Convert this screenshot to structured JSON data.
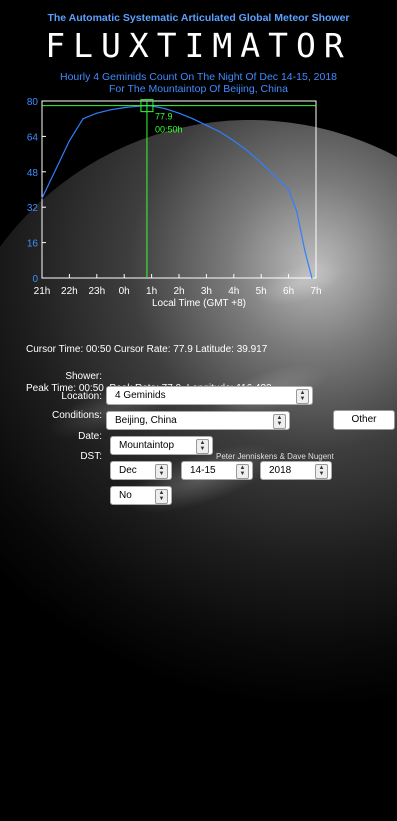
{
  "header": {
    "subtitle": "The Automatic Systematic Articulated Global Meteor Shower",
    "logo": "FLUXTIMATOR"
  },
  "chart_title_line1": "Hourly 4 Geminids  Count On The Night Of Dec 14-15, 2018",
  "chart_title_line2": "For The Mountaintop Of Beijing, China",
  "chart_data": {
    "type": "line",
    "title": "Hourly 4 Geminids  Count On The Night Of Dec 14-15, 2018 For The Mountaintop Of Beijing, China",
    "xlabel": "Local Time (GMT +8)",
    "ylabel": "",
    "x_tick_labels": [
      "21h",
      "22h",
      "23h",
      "0h",
      "1h",
      "2h",
      "3h",
      "4h",
      "5h",
      "6h",
      "7h"
    ],
    "y_ticks": [
      0,
      16,
      32,
      48,
      64,
      80
    ],
    "ylim": [
      0,
      80
    ],
    "xlim": [
      21,
      31
    ],
    "series": [
      {
        "x": [
          21,
          21.5,
          22,
          22.5,
          23,
          23.5,
          24,
          24.5,
          24.83,
          25,
          25.5,
          26,
          26.5,
          27,
          27.5,
          28,
          28.5,
          29,
          29.5,
          30,
          30.3,
          30.6,
          30.85
        ],
        "values": [
          36,
          49,
          62,
          72,
          74.5,
          76,
          77,
          77.6,
          77.9,
          77.8,
          76.5,
          74.5,
          72,
          69,
          66,
          62,
          57.5,
          52,
          46,
          40,
          30,
          12,
          0
        ]
      }
    ],
    "cursor": {
      "x": 24.83,
      "y": 77.9,
      "label_rate": "77.9",
      "label_time": "00:50h"
    },
    "colors": {
      "line": "#2f7fff",
      "cursor": "#33ff33",
      "frame": "#ffffff"
    }
  },
  "stats": {
    "cursor_time_label": "Cursor Time:",
    "cursor_time": "00:50",
    "cursor_rate_label": "Cursor Rate:",
    "cursor_rate": "77.9",
    "latitude_label": "Latitude:",
    "latitude": "39.917",
    "peak_time_label": "Peak Time:",
    "peak_time": "00:50",
    "peak_rate_label": "Peak Rate:",
    "peak_rate": "77.9",
    "longitude_label": "Longitude:",
    "longitude": "116.433"
  },
  "form": {
    "shower_label": "Shower:",
    "location_label": "Location:",
    "conditions_label": "Conditions:",
    "date_label": "Date:",
    "dst_label": "DST:",
    "shower_value": "4 Geminids",
    "location_value": "Beijing, China",
    "other_button": "Other",
    "conditions_value": "Mountaintop",
    "month_value": "Dec",
    "day_value": "14-15",
    "year_value": "2018",
    "dst_value": "No"
  },
  "credit": "Peter Jenniskens & Dave Nugent"
}
